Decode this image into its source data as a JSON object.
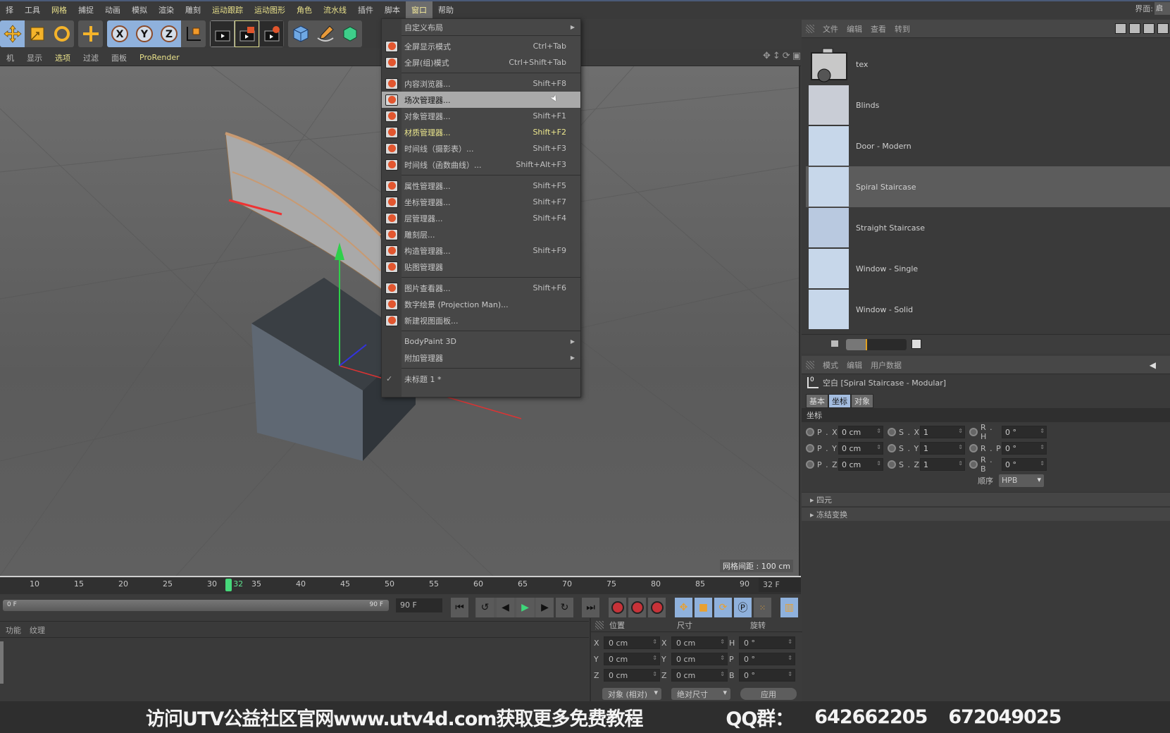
{
  "menubar": {
    "items": [
      "择",
      "工具",
      "网格",
      "捕捉",
      "动画",
      "模拟",
      "渲染",
      "雕刻",
      "运动跟踪",
      "运动图形",
      "角色",
      "流水线",
      "插件",
      "脚本",
      "窗口",
      "帮助"
    ],
    "highlighted": [
      "网格",
      "运动跟踪",
      "运动图形",
      "角色",
      "流水线"
    ],
    "active": "窗口",
    "ui_label": "界面:",
    "ui_value": "启"
  },
  "toolbar": {
    "buttons": [
      "move-tool",
      "scale-tool",
      "rotate-tool",
      "live-select",
      "x-axis-lock",
      "y-axis-lock",
      "z-axis-lock",
      "coordinate-system",
      "render-view",
      "render-picture-viewer",
      "render-settings",
      "cube-object",
      "pen-spline",
      "subdivision-surface"
    ]
  },
  "viewport_menu": {
    "items": [
      "机",
      "显示",
      "选项",
      "过滤",
      "面板",
      "ProRender"
    ],
    "highlighted": [
      "选项",
      "ProRender"
    ]
  },
  "viewport": {
    "grid_spacing": "网格间距 : 100 cm"
  },
  "window_menu": {
    "items": [
      {
        "label": "自定义布局",
        "shortcut": "",
        "submenu": true,
        "icon": "none"
      },
      {
        "sep": true
      },
      {
        "label": "全屏显示模式",
        "shortcut": "Ctrl+Tab",
        "icon": "fullscreen-icon"
      },
      {
        "label": "全屏(组)模式",
        "shortcut": "Ctrl+Shift+Tab",
        "icon": "fullscreen-group-icon"
      },
      {
        "sep": true
      },
      {
        "label": "内容浏览器...",
        "shortcut": "Shift+F8",
        "icon": "content-browser-icon"
      },
      {
        "label": "场次管理器...",
        "shortcut": "",
        "icon": "take-manager-icon",
        "hover": true
      },
      {
        "label": "对象管理器...",
        "shortcut": "Shift+F1",
        "icon": "object-manager-icon"
      },
      {
        "label": "材质管理器...",
        "shortcut": "Shift+F2",
        "icon": "material-manager-icon",
        "yellow": true
      },
      {
        "label": "时间线（摄影表）...",
        "shortcut": "Shift+F3",
        "icon": "timeline-dopesheet-icon"
      },
      {
        "label": "时间线（函数曲线）...",
        "shortcut": "Shift+Alt+F3",
        "icon": "timeline-fcurve-icon"
      },
      {
        "sep": true
      },
      {
        "label": "属性管理器...",
        "shortcut": "Shift+F5",
        "icon": "attribute-manager-icon"
      },
      {
        "label": "坐标管理器...",
        "shortcut": "Shift+F7",
        "icon": "coordinate-manager-icon"
      },
      {
        "label": "层管理器...",
        "shortcut": "Shift+F4",
        "icon": "layer-manager-icon"
      },
      {
        "label": "雕刻层...",
        "shortcut": "",
        "icon": "sculpt-layer-icon"
      },
      {
        "label": "构造管理器...",
        "shortcut": "Shift+F9",
        "icon": "structure-manager-icon"
      },
      {
        "label": "贴图管理器",
        "shortcut": "",
        "icon": "texture-manager-icon"
      },
      {
        "sep": true
      },
      {
        "label": "图片查看器...",
        "shortcut": "Shift+F6",
        "icon": "picture-viewer-icon"
      },
      {
        "label": "数字绘景 (Projection Man)...",
        "shortcut": "",
        "icon": "projection-man-icon"
      },
      {
        "label": "新建视图面板...",
        "shortcut": "",
        "icon": "new-view-panel-icon"
      },
      {
        "sep": true
      },
      {
        "label": "BodyPaint 3D",
        "shortcut": "",
        "submenu": true,
        "icon": "none"
      },
      {
        "label": "附加管理器",
        "shortcut": "",
        "submenu": true,
        "icon": "none"
      },
      {
        "sep": true
      },
      {
        "label": "未标题 1 *",
        "shortcut": "",
        "icon": "check",
        "checked": true
      }
    ]
  },
  "content_browser": {
    "menu": [
      "文件",
      "编辑",
      "查看",
      "转到"
    ],
    "items": [
      {
        "name": "tex",
        "type": "locked-folder"
      },
      {
        "name": "Blinds",
        "type": "preset"
      },
      {
        "name": "Door - Modern",
        "type": "preset"
      },
      {
        "name": "Spiral Staircase",
        "type": "preset",
        "selected": true
      },
      {
        "name": "Straight Staircase",
        "type": "preset"
      },
      {
        "name": "Window - Single",
        "type": "preset"
      },
      {
        "name": "Window - Solid",
        "type": "preset"
      }
    ],
    "thumbnail_size_fraction": 0.35
  },
  "attribute_manager": {
    "menu": [
      "模式",
      "编辑",
      "用户数据"
    ],
    "object_title": "空白 [Spiral Staircase - Modular]",
    "tabs": [
      {
        "label": "基本"
      },
      {
        "label": "坐标",
        "active": true
      },
      {
        "label": "对象"
      }
    ],
    "section": "坐标",
    "rows": [
      [
        {
          "label": "P . X",
          "value": "0 cm"
        },
        {
          "label": "S . X",
          "value": "1"
        },
        {
          "label": "R . H",
          "value": "0 °"
        }
      ],
      [
        {
          "label": "P . Y",
          "value": "0 cm"
        },
        {
          "label": "S . Y",
          "value": "1"
        },
        {
          "label": "R . P",
          "value": "0 °"
        }
      ],
      [
        {
          "label": "P . Z",
          "value": "0 cm"
        },
        {
          "label": "S . Z",
          "value": "1"
        },
        {
          "label": "R . B",
          "value": "0 °"
        }
      ]
    ],
    "order_label": "顺序",
    "order_value": "HPB",
    "collapsibles": [
      "四元",
      "冻结变换"
    ]
  },
  "timeline": {
    "ticks": [
      10,
      15,
      20,
      25,
      30,
      35,
      40,
      45,
      50,
      55,
      60,
      65,
      70,
      75,
      80,
      85,
      90
    ],
    "current_frame": 32,
    "current_frame_label": "32",
    "current_frame_field": "32 F",
    "range_start": "0 F",
    "range_end": "90 F",
    "end_frame_field": "90 F"
  },
  "transport": {
    "buttons": [
      "go-to-start",
      "previous-key",
      "previous-frame",
      "play-forward",
      "next-frame",
      "next-key",
      "go-to-end",
      "record-active-objects",
      "autokey",
      "keyframe-selection",
      "position-key",
      "scale-key",
      "rotation-key",
      "parameter-key",
      "point-level-animation",
      "timeline-toggle"
    ]
  },
  "material_panel": {
    "menu": [
      "功能",
      "纹理"
    ]
  },
  "coordinates_panel": {
    "headers": [
      "位置",
      "尺寸",
      "旋转"
    ],
    "rows": [
      {
        "pl": "X",
        "pv": "0 cm",
        "sl": "X",
        "sv": "0 cm",
        "rl": "H",
        "rv": "0 °"
      },
      {
        "pl": "Y",
        "pv": "0 cm",
        "sl": "Y",
        "sv": "0 cm",
        "rl": "P",
        "rv": "0 °"
      },
      {
        "pl": "Z",
        "pv": "0 cm",
        "sl": "Z",
        "sv": "0 cm",
        "rl": "B",
        "rv": "0 °"
      }
    ],
    "mode_select": "对象 (相对)",
    "size_select": "绝对尺寸",
    "apply_label": "应用"
  },
  "banner": {
    "text1": "访问UTV公益社区官网www.utv4d.com获取更多免费教程",
    "text2": "QQ群：",
    "qq1": "642662205",
    "qq2": "672049025"
  }
}
